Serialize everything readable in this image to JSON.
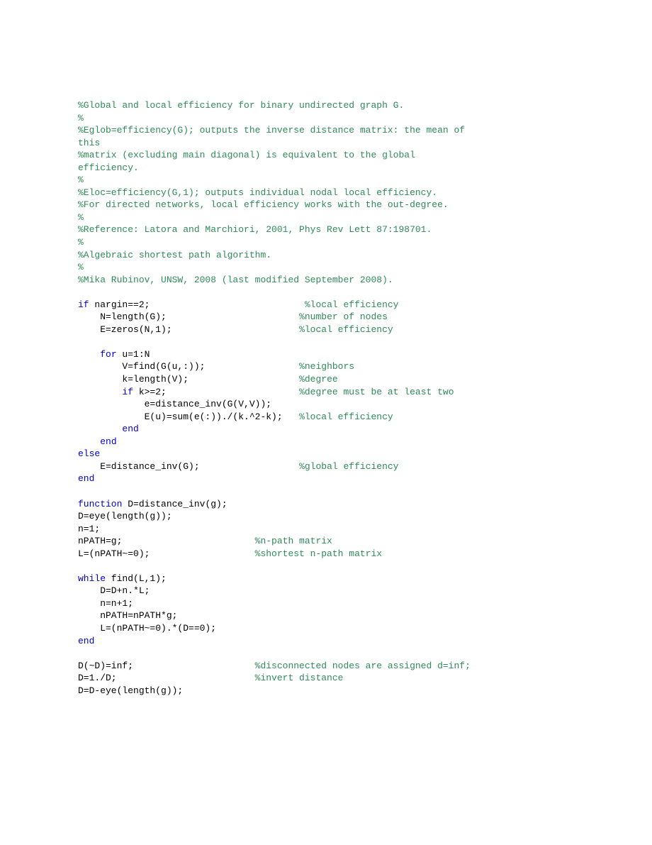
{
  "code": {
    "lines": [
      {
        "tokens": [
          {
            "t": "%Global and local efficiency for binary undirected graph G.",
            "c": "comment"
          }
        ]
      },
      {
        "tokens": [
          {
            "t": "%",
            "c": "comment"
          }
        ]
      },
      {
        "tokens": [
          {
            "t": "%Eglob=efficiency(G); outputs the inverse distance matrix: the mean of ",
            "c": "comment"
          }
        ]
      },
      {
        "tokens": [
          {
            "t": "this",
            "c": "comment"
          }
        ]
      },
      {
        "tokens": [
          {
            "t": "%matrix (excluding main diagonal) is equivalent to the global ",
            "c": "comment"
          }
        ]
      },
      {
        "tokens": [
          {
            "t": "efficiency.",
            "c": "comment"
          }
        ]
      },
      {
        "tokens": [
          {
            "t": "%",
            "c": "comment"
          }
        ]
      },
      {
        "tokens": [
          {
            "t": "%Eloc=efficiency(G,1); outputs individual nodal local efficiency.",
            "c": "comment"
          }
        ]
      },
      {
        "tokens": [
          {
            "t": "%For directed networks, local efficiency works with the out-degree.",
            "c": "comment"
          }
        ]
      },
      {
        "tokens": [
          {
            "t": "%",
            "c": "comment"
          }
        ]
      },
      {
        "tokens": [
          {
            "t": "%Reference: Latora and Marchiori, 2001, Phys Rev Lett 87:198701.",
            "c": "comment"
          }
        ]
      },
      {
        "tokens": [
          {
            "t": "%",
            "c": "comment"
          }
        ]
      },
      {
        "tokens": [
          {
            "t": "%Algebraic shortest path algorithm.",
            "c": "comment"
          }
        ]
      },
      {
        "tokens": [
          {
            "t": "%",
            "c": "comment"
          }
        ]
      },
      {
        "tokens": [
          {
            "t": "%Mika Rubinov, UNSW, 2008 (last modified September 2008).",
            "c": "comment"
          }
        ]
      },
      {
        "tokens": [
          {
            "t": " ",
            "c": "plain"
          }
        ]
      },
      {
        "tokens": [
          {
            "t": "if",
            "c": "keyword"
          },
          {
            "t": " nargin==2;                            ",
            "c": "plain"
          },
          {
            "t": "%local efficiency",
            "c": "comment"
          }
        ]
      },
      {
        "tokens": [
          {
            "t": "    N=length(G);                        ",
            "c": "plain"
          },
          {
            "t": "%number of nodes",
            "c": "comment"
          }
        ]
      },
      {
        "tokens": [
          {
            "t": "    E=zeros(N,1);                       ",
            "c": "plain"
          },
          {
            "t": "%local efficiency",
            "c": "comment"
          }
        ]
      },
      {
        "tokens": [
          {
            "t": " ",
            "c": "plain"
          }
        ]
      },
      {
        "tokens": [
          {
            "t": "    ",
            "c": "plain"
          },
          {
            "t": "for",
            "c": "keyword"
          },
          {
            "t": " u=1:N",
            "c": "plain"
          }
        ]
      },
      {
        "tokens": [
          {
            "t": "        V=find(G(u,:));                 ",
            "c": "plain"
          },
          {
            "t": "%neighbors",
            "c": "comment"
          }
        ]
      },
      {
        "tokens": [
          {
            "t": "        k=length(V);                    ",
            "c": "plain"
          },
          {
            "t": "%degree",
            "c": "comment"
          }
        ]
      },
      {
        "tokens": [
          {
            "t": "        ",
            "c": "plain"
          },
          {
            "t": "if",
            "c": "keyword"
          },
          {
            "t": " k>=2;                        ",
            "c": "plain"
          },
          {
            "t": "%degree must be at least two",
            "c": "comment"
          }
        ]
      },
      {
        "tokens": [
          {
            "t": "            e=distance_inv(G(V,V));",
            "c": "plain"
          }
        ]
      },
      {
        "tokens": [
          {
            "t": "            E(u)=sum(e(:))./(k.^2-k);   ",
            "c": "plain"
          },
          {
            "t": "%local efficiency",
            "c": "comment"
          }
        ]
      },
      {
        "tokens": [
          {
            "t": "        ",
            "c": "plain"
          },
          {
            "t": "end",
            "c": "keyword"
          }
        ]
      },
      {
        "tokens": [
          {
            "t": "    ",
            "c": "plain"
          },
          {
            "t": "end",
            "c": "keyword"
          }
        ]
      },
      {
        "tokens": [
          {
            "t": "else",
            "c": "keyword"
          }
        ]
      },
      {
        "tokens": [
          {
            "t": "    E=distance_inv(G);                  ",
            "c": "plain"
          },
          {
            "t": "%global efficiency",
            "c": "comment"
          }
        ]
      },
      {
        "tokens": [
          {
            "t": "end",
            "c": "keyword"
          }
        ]
      },
      {
        "tokens": [
          {
            "t": " ",
            "c": "plain"
          }
        ]
      },
      {
        "tokens": [
          {
            "t": "function",
            "c": "keyword"
          },
          {
            "t": " D=distance_inv(g);",
            "c": "plain"
          }
        ]
      },
      {
        "tokens": [
          {
            "t": "D=eye(length(g));",
            "c": "plain"
          }
        ]
      },
      {
        "tokens": [
          {
            "t": "n=1;",
            "c": "plain"
          }
        ]
      },
      {
        "tokens": [
          {
            "t": "nPATH=g;                        ",
            "c": "plain"
          },
          {
            "t": "%n-path matrix",
            "c": "comment"
          }
        ]
      },
      {
        "tokens": [
          {
            "t": "L=(nPATH~=0);                   ",
            "c": "plain"
          },
          {
            "t": "%shortest n-path matrix",
            "c": "comment"
          }
        ]
      },
      {
        "tokens": [
          {
            "t": " ",
            "c": "plain"
          }
        ]
      },
      {
        "tokens": [
          {
            "t": "while",
            "c": "keyword"
          },
          {
            "t": " find(L,1);",
            "c": "plain"
          }
        ]
      },
      {
        "tokens": [
          {
            "t": "    D=D+n.*L;",
            "c": "plain"
          }
        ]
      },
      {
        "tokens": [
          {
            "t": "    n=n+1;",
            "c": "plain"
          }
        ]
      },
      {
        "tokens": [
          {
            "t": "    nPATH=nPATH*g;",
            "c": "plain"
          }
        ]
      },
      {
        "tokens": [
          {
            "t": "    L=(nPATH~=0).*(D==0);",
            "c": "plain"
          }
        ]
      },
      {
        "tokens": [
          {
            "t": "end",
            "c": "keyword"
          }
        ]
      },
      {
        "tokens": [
          {
            "t": " ",
            "c": "plain"
          }
        ]
      },
      {
        "tokens": [
          {
            "t": "D(~D)=inf;                      ",
            "c": "plain"
          },
          {
            "t": "%disconnected nodes are assigned d=inf;",
            "c": "comment"
          }
        ]
      },
      {
        "tokens": [
          {
            "t": "D=1./D;                         ",
            "c": "plain"
          },
          {
            "t": "%invert distance",
            "c": "comment"
          }
        ]
      },
      {
        "tokens": [
          {
            "t": "D=D-eye(length(g));",
            "c": "plain"
          }
        ]
      }
    ]
  }
}
